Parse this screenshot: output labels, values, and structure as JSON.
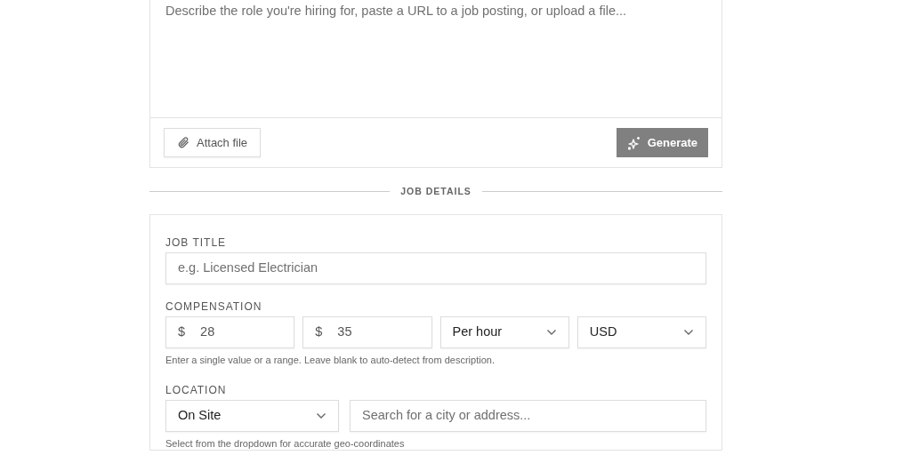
{
  "composer": {
    "placeholder": "Describe the role you're hiring for, paste a URL to a job posting, or upload a file...",
    "attach_button": "Attach file",
    "generate_button": {
      "label": "Generate",
      "disabled": true
    }
  },
  "section_divider": "JOB DETAILS",
  "job_title": {
    "label": "JOB TITLE",
    "placeholder": "e.g. Licensed Electrician"
  },
  "compensation": {
    "label": "COMPENSATION",
    "fields": [
      {
        "kind": "amount",
        "prefix": "$",
        "value": "28"
      },
      {
        "kind": "amount",
        "prefix": "$",
        "value": "35"
      },
      {
        "kind": "select",
        "value": "Per hour"
      },
      {
        "kind": "select",
        "value": "USD"
      }
    ],
    "hint": "Enter a single value or a range. Leave blank to auto-detect from description."
  },
  "location": {
    "label": "LOCATION",
    "type_select": "On Site",
    "search_placeholder": "Search for a city or address...",
    "hint": "Select from the dropdown for accurate geo-coordinates"
  }
}
